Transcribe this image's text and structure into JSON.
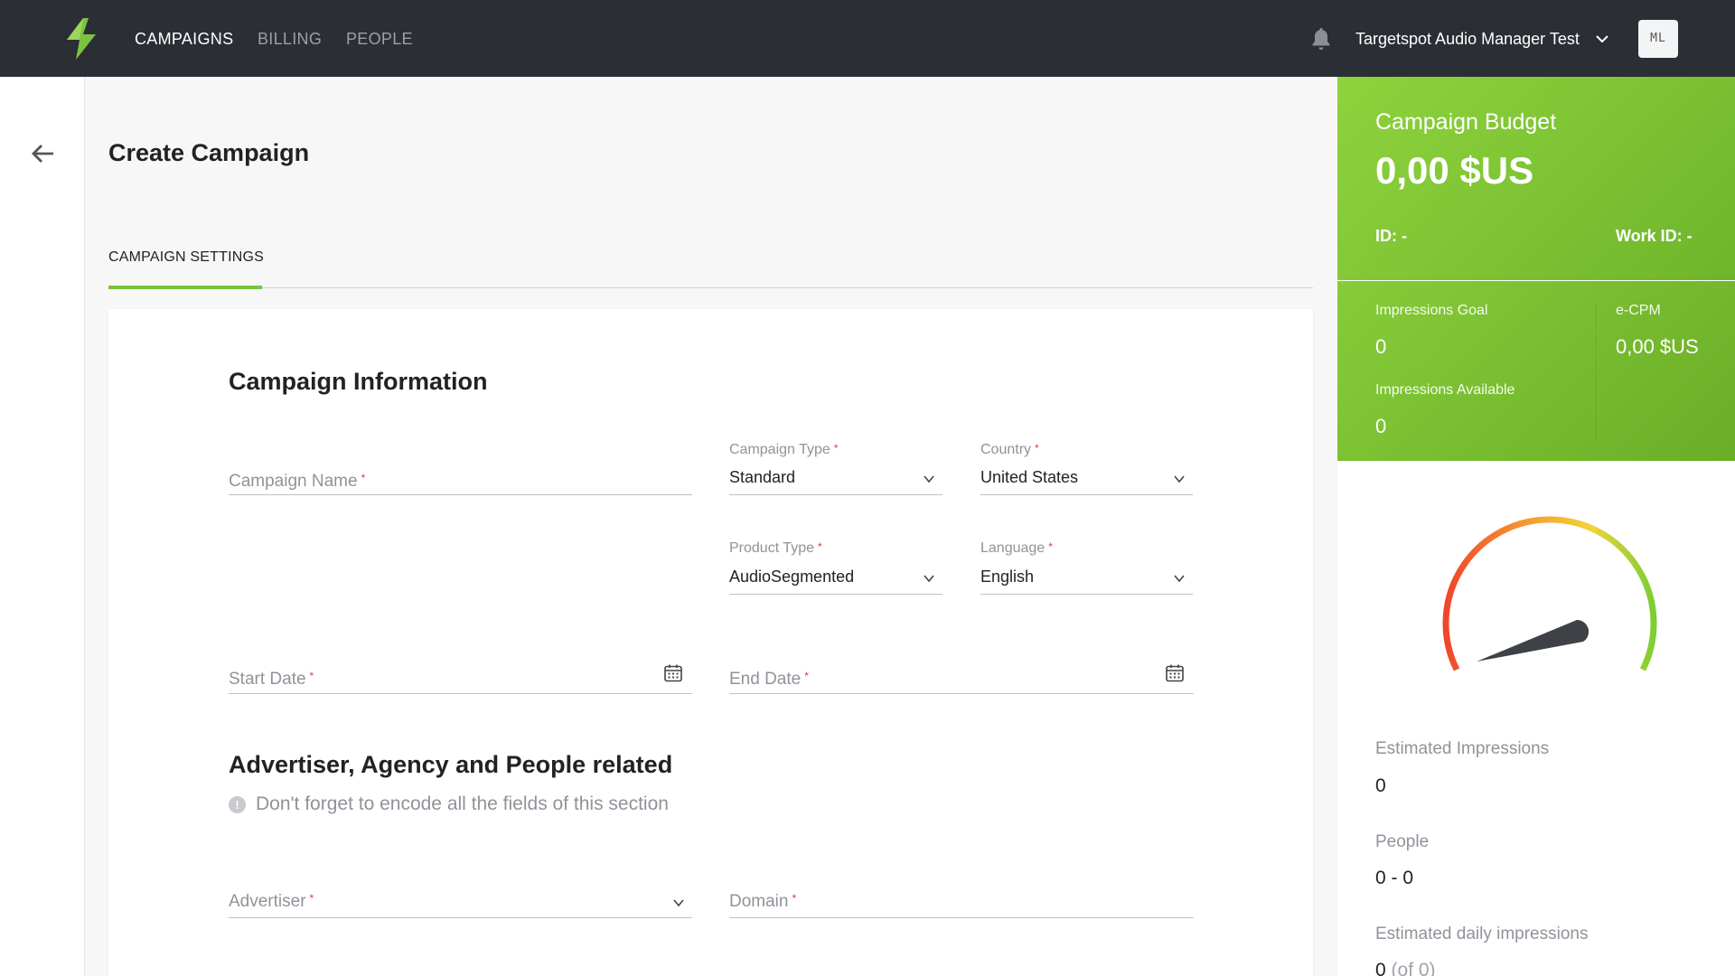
{
  "nav": {
    "items": [
      {
        "label": "CAMPAIGNS",
        "active": true
      },
      {
        "label": "BILLING",
        "active": false
      },
      {
        "label": "PEOPLE",
        "active": false
      }
    ],
    "account_name": "Targetspot Audio Manager Test",
    "avatar_initials": "ML",
    "icons": {
      "logo": "lightning-bolt-icon",
      "notifications": "bell-icon",
      "account_menu": "chevron-down-icon"
    }
  },
  "page": {
    "title": "Create Campaign",
    "tabs": [
      {
        "label": "CAMPAIGN SETTINGS",
        "active": true
      }
    ]
  },
  "campaign_info": {
    "title": "Campaign Information",
    "campaign_name": {
      "label": "Campaign Name",
      "value": ""
    },
    "campaign_type": {
      "label": "Campaign Type",
      "value": "Standard"
    },
    "country": {
      "label": "Country",
      "value": "United States"
    },
    "product_type": {
      "label": "Product Type",
      "value": "AudioSegmented"
    },
    "language": {
      "label": "Language",
      "value": "English"
    },
    "start_date": {
      "label": "Start Date",
      "value": ""
    },
    "end_date": {
      "label": "End Date",
      "value": ""
    }
  },
  "advertiser_section": {
    "title": "Advertiser, Agency and People related",
    "hint": "Don't forget to encode all the fields of this section",
    "advertiser": {
      "label": "Advertiser",
      "value": ""
    },
    "domain": {
      "label": "Domain",
      "value": ""
    }
  },
  "summary": {
    "budget_label": "Campaign Budget",
    "budget_value": "0,00 $US",
    "id_label": "ID: -",
    "work_id_label": "Work ID: -",
    "impressions_goal_label": "Impressions Goal",
    "impressions_goal_value": "0",
    "ecpm_label": "e-CPM",
    "ecpm_value": "0,00 $US",
    "impressions_available_label": "Impressions Available",
    "impressions_available_value": "0",
    "estimated_impressions_label": "Estimated Impressions",
    "estimated_impressions_value": "0",
    "people_label": "People",
    "people_value": "0 - 0",
    "daily_impressions_label": "Estimated daily impressions",
    "daily_impressions_value": "0",
    "daily_impressions_sub": "(of 0)"
  },
  "colors": {
    "accent_green": "#7cc242",
    "nav_bg": "#2b2e34",
    "required": "#e53935"
  }
}
